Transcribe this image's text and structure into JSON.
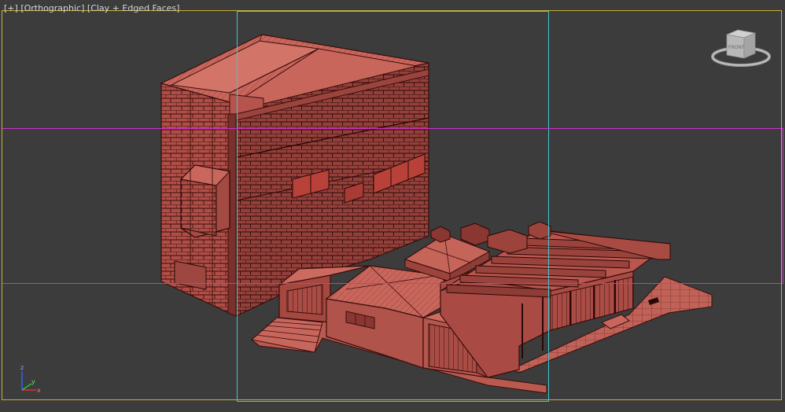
{
  "viewport": {
    "label": {
      "menu": "[+]",
      "view": "[Orthographic]",
      "shading": "[Clay + Edged Faces]"
    },
    "colors": {
      "background": "#3c3c3c",
      "active_border": "#c8b032",
      "safe_frame_cyan": "#40c8d0",
      "safe_frame_magenta": "#d030d0",
      "clay": "#b9574f",
      "clay_dark": "#8e3c36",
      "clay_light": "#d06b60",
      "edge": "#3a0e0c"
    }
  },
  "viewcube": {
    "face_label": "FRONT",
    "icon": "viewcube-icon"
  },
  "axis_tripod": {
    "z_label": "z",
    "x_label": "x",
    "y_label": "y",
    "colors": {
      "x": "#e03030",
      "y": "#30c030",
      "z": "#3060ff"
    }
  }
}
